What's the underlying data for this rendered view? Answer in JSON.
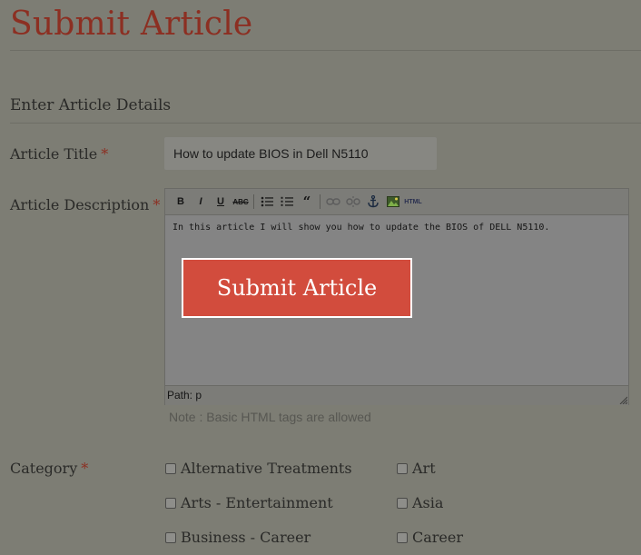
{
  "page": {
    "title": "Submit Article"
  },
  "form": {
    "section_heading": "Enter Article Details",
    "required_mark": "*",
    "title_label": "Article Title",
    "title_value": "How to update BIOS in Dell N5110",
    "description_label": "Article Description",
    "description_text": "In this article I will show you how to update the BIOS of DELL N5110.",
    "toolbar": {
      "bold": "B",
      "italic": "I",
      "underline": "U",
      "strikethrough": "ABC",
      "html": "HTML"
    },
    "status_path": "Path: p",
    "note": "Note : Basic HTML tags are allowed",
    "category_label": "Category",
    "categories": [
      "Alternative Treatments",
      "Art",
      "Arts - Entertainment",
      "Asia",
      "Business - Career",
      "Career"
    ]
  },
  "overlay": {
    "submit_label": "Submit Article"
  },
  "colors": {
    "accent": "#8c2f22",
    "button": "#d24c3d",
    "background": "#7d7d74"
  }
}
